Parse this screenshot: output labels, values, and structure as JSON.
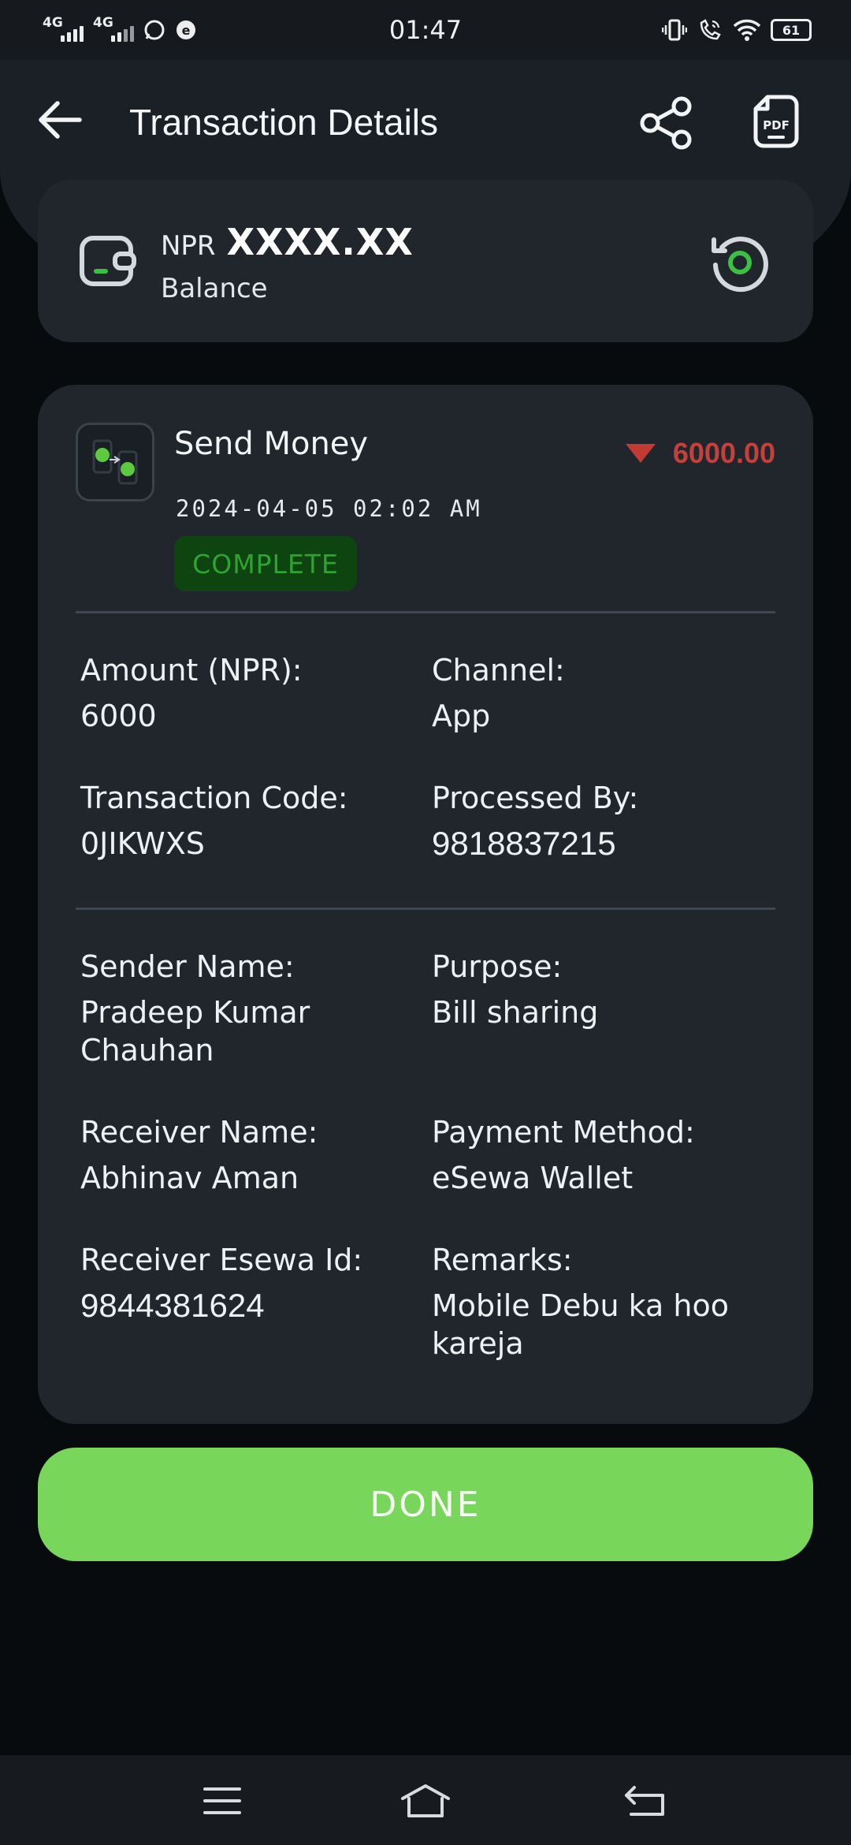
{
  "status_bar": {
    "time": "01:47",
    "network_1": "4G",
    "network_2": "4G",
    "battery": "61"
  },
  "header": {
    "title": "Transaction Details"
  },
  "balance": {
    "currency": "NPR",
    "amount": "XXXX.XX",
    "label": "Balance"
  },
  "transaction": {
    "type": "Send Money",
    "datetime": "2024-04-05 02:02 AM",
    "status": "COMPLETE",
    "amount": "6000.00",
    "direction": "debit",
    "debit_color": "#c5403a",
    "status_color": "#2fa330"
  },
  "details": {
    "amount_label": "Amount (NPR):",
    "amount_value": "6000",
    "channel_label": "Channel:",
    "channel_value": "App",
    "code_label": "Transaction Code:",
    "code_value": "0JIKWXS",
    "processed_label": "Processed By:",
    "processed_value": "9818837215",
    "sender_label": "Sender Name:",
    "sender_value": "Pradeep Kumar Chauhan",
    "purpose_label": "Purpose:",
    "purpose_value": "Bill sharing",
    "receiver_label": "Receiver Name:",
    "receiver_value": "Abhinav Aman",
    "method_label": "Payment Method:",
    "method_value": "eSewa Wallet",
    "esewa_id_label": "Receiver Esewa Id:",
    "esewa_id_value": "9844381624",
    "remarks_label": "Remarks:",
    "remarks_value": "Mobile Debu ka hoo kareja"
  },
  "actions": {
    "done_label": "DONE"
  },
  "icons": {
    "back": "arrow-left-icon",
    "share": "share-icon",
    "pdf": "pdf-icon",
    "wallet": "wallet-icon",
    "refresh": "refresh-icon",
    "send_money": "send-money-icon",
    "menu": "menu-icon",
    "home": "home-icon",
    "nav_back": "nav-back-icon"
  },
  "colors": {
    "accent": "#78d65a",
    "background": "#080b0e",
    "card": "#21262d"
  }
}
